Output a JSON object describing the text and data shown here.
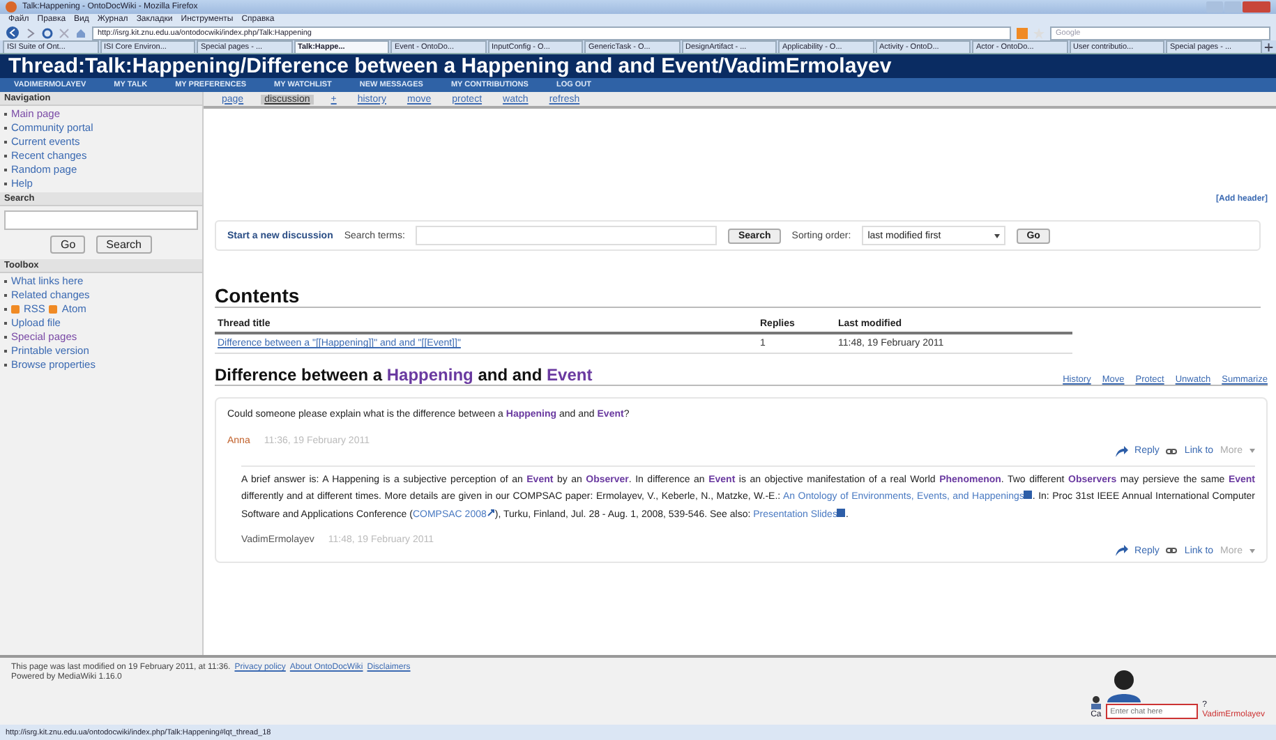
{
  "browser": {
    "title": "Talk:Happening - OntoDocWiki - Mozilla Firefox",
    "menu": [
      "Файл",
      "Правка",
      "Вид",
      "Журнал",
      "Закладки",
      "Инструменты",
      "Справка"
    ],
    "url": "http://isrg.kit.znu.edu.ua/ontodocwiki/index.php/Talk:Happening",
    "search_placeholder": "Google",
    "tabs": [
      {
        "label": "ISI Suite of Ont...",
        "selected": false
      },
      {
        "label": "ISI Core Environ...",
        "selected": false
      },
      {
        "label": "Special pages - ...",
        "selected": false
      },
      {
        "label": "Talk:Happe...",
        "selected": true
      },
      {
        "label": "Event - OntoDo...",
        "selected": false
      },
      {
        "label": "InputConfig - O...",
        "selected": false
      },
      {
        "label": "GenericTask - O...",
        "selected": false
      },
      {
        "label": "DesignArtifact - ...",
        "selected": false
      },
      {
        "label": "Applicability - O...",
        "selected": false
      },
      {
        "label": "Activity - OntoD...",
        "selected": false
      },
      {
        "label": "Actor - OntoDo...",
        "selected": false
      },
      {
        "label": "User contributio...",
        "selected": false
      },
      {
        "label": "Special pages - ...",
        "selected": false
      }
    ],
    "status_url": "http://isrg.kit.znu.edu.ua/ontodocwiki/index.php/Talk:Happening#lqt_thread_18"
  },
  "wiki": {
    "title": "Thread:Talk:Happening/Difference between a Happening and and Event/VadimErmolayev",
    "user_links": [
      "VADIMERMOLAYEV",
      "MY TALK",
      "MY PREFERENCES",
      "MY WATCHLIST",
      "NEW MESSAGES",
      "MY CONTRIBUTIONS",
      "LOG OUT"
    ],
    "page_tabs": [
      {
        "label": "page",
        "selected": false
      },
      {
        "label": "discussion",
        "selected": true
      },
      {
        "label": "+",
        "selected": false
      },
      {
        "label": "history",
        "selected": false
      },
      {
        "label": "move",
        "selected": false
      },
      {
        "label": "protect",
        "selected": false
      },
      {
        "label": "watch",
        "selected": false
      },
      {
        "label": "refresh",
        "selected": false
      }
    ],
    "sidebar": [
      {
        "kind": "links",
        "heading": "Navigation",
        "items": [
          {
            "label": "Main page",
            "visited": true
          },
          {
            "label": "Community portal",
            "visited": false
          },
          {
            "label": "Current events",
            "visited": false
          },
          {
            "label": "Recent changes",
            "visited": false
          },
          {
            "label": "Random page",
            "visited": false
          },
          {
            "label": "Help",
            "visited": false
          }
        ]
      },
      {
        "kind": "search",
        "heading": "Search",
        "buttons": [
          "Go",
          "Search"
        ]
      },
      {
        "kind": "links",
        "heading": "Toolbox",
        "items": [
          {
            "label": "What links here",
            "visited": false
          },
          {
            "label": "Related changes",
            "visited": false
          },
          {
            "kind": "feeds",
            "feeds": [
              "RSS",
              "Atom"
            ]
          },
          {
            "label": "Upload file",
            "visited": false
          },
          {
            "label": "Special pages",
            "visited": true
          },
          {
            "label": "Printable version",
            "visited": false
          },
          {
            "label": "Browse properties",
            "visited": false
          }
        ]
      }
    ],
    "add_header": "[Add header]",
    "discussion_bar": {
      "start": "Start a new discussion",
      "search_label": "Search terms:",
      "search_button": "Search",
      "sort_label": "Sorting order:",
      "sort_value": "last modified first",
      "go_button": "Go"
    },
    "contents": {
      "heading": "Contents",
      "columns": [
        "Thread title",
        "Replies",
        "Last modified"
      ],
      "rows": [
        {
          "title": "Difference between a \"[[Happening]]\" and and \"[[Event]]\"",
          "replies": "1",
          "modified": "11:48, 19 February 2011"
        }
      ]
    },
    "thread": {
      "heading": [
        {
          "kind": "text",
          "text": "Difference between a "
        },
        {
          "kind": "term",
          "text": "Happening"
        },
        {
          "kind": "text",
          "text": " and and "
        },
        {
          "kind": "term",
          "text": "Event"
        }
      ],
      "actions": [
        "History",
        "Move",
        "Protect",
        "Unwatch",
        "Summarize"
      ],
      "posts": [
        {
          "body": [
            {
              "kind": "text",
              "text": "Could someone please explain what is the difference between a "
            },
            {
              "kind": "term",
              "text": "Happening"
            },
            {
              "kind": "text",
              "text": " and and "
            },
            {
              "kind": "term",
              "text": "Event"
            },
            {
              "kind": "text",
              "text": "?"
            }
          ],
          "author": "Anna",
          "color": "#c0602a",
          "time": "11:36, 19 February 2011",
          "reply": "Reply",
          "link": "Link to",
          "more": "More",
          "indent": false
        },
        {
          "body": [
            {
              "kind": "text",
              "text": "A brief answer is: A Happening is a subjective perception of an "
            },
            {
              "kind": "term",
              "text": "Event"
            },
            {
              "kind": "text",
              "text": " by an "
            },
            {
              "kind": "term",
              "text": "Observer"
            },
            {
              "kind": "text",
              "text": ". In difference an "
            },
            {
              "kind": "term",
              "text": "Event"
            },
            {
              "kind": "text",
              "text": " is an objective manifestation of a real World "
            },
            {
              "kind": "term",
              "text": "Phenomenon"
            },
            {
              "kind": "text",
              "text": ". Two different "
            },
            {
              "kind": "term",
              "text": "Observers"
            },
            {
              "kind": "text",
              "text": " may persieve the same "
            },
            {
              "kind": "term",
              "text": "Event"
            },
            {
              "kind": "text",
              "text": " differently and at different times. More details are given in our COMPSAC paper: Ermolayev, V., Keberle, N., Matzke, W.-E.: "
            },
            {
              "kind": "pdf_link",
              "text": "An Ontology of Environments, Events, and Happenings"
            },
            {
              "kind": "text",
              "text": ". In: Proc 31st IEEE Annual International Computer Software and Applications Conference ("
            },
            {
              "kind": "ext_link",
              "text": "COMPSAC 2008"
            },
            {
              "kind": "text",
              "text": "), Turku, Finland, Jul. 28 - Aug. 1, 2008, 539-546. See also: "
            },
            {
              "kind": "pdf_link",
              "text": "Presentation Slides"
            },
            {
              "kind": "text",
              "text": "."
            }
          ],
          "author": "VadimErmolayev",
          "color": "#555555",
          "time": "11:48, 19 February 2011",
          "reply": "Reply",
          "link": "Link to",
          "more": "More",
          "indent": true
        }
      ]
    },
    "footer": [
      "This page was last modified on 19 February 2011, at 11:36.",
      "Privacy policy",
      "About OntoDocWiki",
      "Disclaimers",
      "Powered by MediaWiki 1.16.0"
    ]
  },
  "chat": {
    "user": "VadimErmolayev",
    "placeholder": "Enter chat here",
    "label": "Ca",
    "controls": "?"
  }
}
